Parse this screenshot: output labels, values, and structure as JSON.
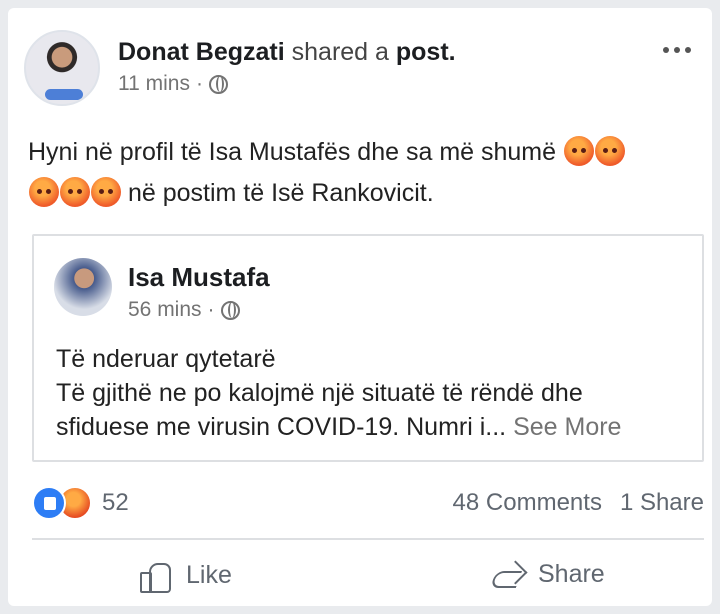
{
  "post": {
    "author": "Donat Begzati",
    "action_prefix": "shared a",
    "action_object": "post.",
    "time": "11 mins",
    "text_before_emojis": "Hyni në  profil të Isa Mustafës dhe sa më shumë",
    "text_after_emojis": "në postim të Isë Rankovicit."
  },
  "shared_post": {
    "author": "Isa Mustafa",
    "time": "56 mins",
    "line_1": "Të nderuar qytetarë",
    "line_2": "Të gjithë ne po kalojmë një situatë të rëndë dhe",
    "line_3": "sfiduese me virusin COVID-19. Numri i...",
    "see_more": "See More"
  },
  "stats": {
    "reaction_count": "52",
    "comments": "48 Comments",
    "shares": "1 Share"
  },
  "actions": {
    "like": "Like",
    "share": "Share"
  },
  "icons": {
    "privacy": "globe-icon",
    "menu": "more-options-icon",
    "reaction_like": "like-reaction-icon",
    "reaction_angry": "angry-reaction-icon",
    "like_button": "thumbs-up-icon",
    "share_button": "share-arrow-icon"
  },
  "colors": {
    "facebook_blue": "#2d7df5",
    "text": "#1c1e21",
    "muted": "#737373",
    "angry": "#ef5b2a"
  }
}
